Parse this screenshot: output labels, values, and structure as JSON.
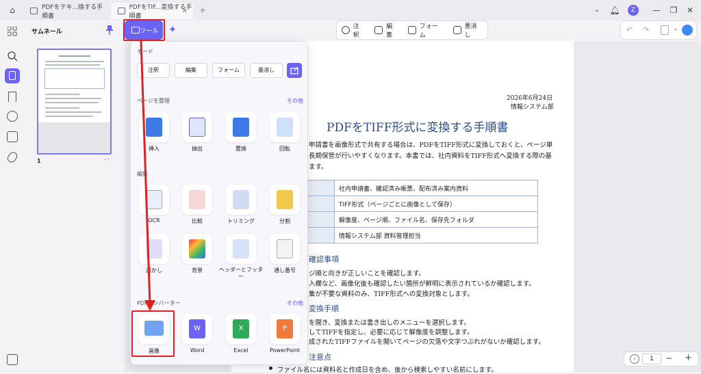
{
  "tabs": [
    {
      "label": "PDFをテキ...換する手順書"
    },
    {
      "label": "PDFをTIF...変換する手順書"
    }
  ],
  "avatar_letter": "Z",
  "main_toolbar": {
    "tool_button": "ツール",
    "items": [
      "注釈",
      "編集",
      "フォーム",
      "墨消し"
    ]
  },
  "left_panel": {
    "title": "サムネール",
    "page_number": "1",
    "more": "···"
  },
  "popup": {
    "mode_title": "モード",
    "mode_buttons": [
      "注釈",
      "編集",
      "フォーム",
      "墨消し"
    ],
    "organize_title": "ページを整理",
    "organize_more": "その他",
    "organize_items": [
      "挿入",
      "抽出",
      "置換",
      "回転"
    ],
    "edit_title": "編集",
    "edit_items_row1": [
      "OCR",
      "比較",
      "トリミング",
      "分割"
    ],
    "edit_items_row2": [
      "透かし",
      "背景",
      "ヘッダーとフッター",
      "通し番号"
    ],
    "convert_title": "PDFコンバーター",
    "convert_more": "その他",
    "convert_items": [
      "画像",
      "Word",
      "Excel",
      "PowerPoint"
    ]
  },
  "document": {
    "date": "2026年6月24日",
    "dept": "情報システム部",
    "title": "PDFをTIFF形式に変換する手順書",
    "intro1": "申請書を画像形式で共有する場合は、PDFをTIFF形式に変換しておくと、ページ単",
    "intro2": "長期保管が行いやすくなります。本書では、社内資料をTIFF形式へ変換する際の基",
    "intro3": "ます。",
    "table": [
      "社内申請書、確認済み帳票、配布済み案内資料",
      "TIFF形式（ページごとに画像として保存）",
      "解像度、ページ順、ファイル名、保存先フォルダ",
      "情報システム部 資料管理担当"
    ],
    "h_check": "確認事項",
    "check1": "ジ順と向きが正しいことを確認します。",
    "check2": "入欄など、画像化後も確認したい箇所が鮮明に表示されているか確認します。",
    "check3": "集が不要な資料のみ、TIFF形式への変換対象とします。",
    "h_steps": "変換手順",
    "step1": "を開き、変換または書き出しのメニューを選択します。",
    "step2": "してTIFFを指定し、必要に応じて解像度を調整します。",
    "step3": "成されたTIFFファイルを開いてページの欠落や文字つぶれがないか確認します。",
    "h_notes": "注意点",
    "note1": "ファイル名には資料名と作成日を含め、後から検索しやすい名前にします。"
  },
  "page_indicator": "1",
  "colors": {
    "accent": "#6b63f5",
    "annotation": "#e02020"
  }
}
